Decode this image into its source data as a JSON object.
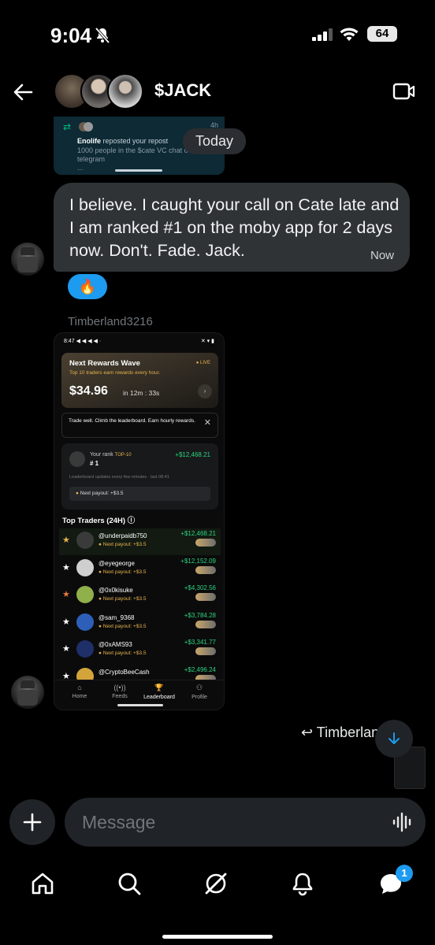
{
  "status_bar": {
    "time": "9:04",
    "battery": "64"
  },
  "header": {
    "title": "$JACK"
  },
  "repost_card": {
    "time": "4h",
    "user": "Enolife",
    "action": "reposted your repost",
    "text": "1000 people in the $cate VC chat o",
    "text2": "telegram",
    "more": "..."
  },
  "date_divider": "Today",
  "message": {
    "text": "I believe. I caught your call on Cate late and I am ranked #1 on the moby app for 2 days now. Don't. Fade. Jack.",
    "time": "Now",
    "reaction": "🔥"
  },
  "shared_by": "Timberland3216",
  "screenshot": {
    "status_time": "8:47",
    "rewards": {
      "title": "Next Rewards Wave",
      "live": "LIVE",
      "subtitle": "Top 10 traders earn rewards every hour.",
      "amount": "$34.96",
      "countdown": "in 12m : 33s"
    },
    "tip": "Trade well. Climb the leaderboard. Earn hourly rewards.",
    "rank": {
      "label": "Your rank",
      "tier": "TOP-10",
      "number": "# 1",
      "pnl": "+$12,468.21",
      "note": "Leaderboard updates every few minutes · last 08:41",
      "payout": "Next payout: +$3.5"
    },
    "top_title": "Top Traders (24H)",
    "traders": [
      {
        "name": "@underpaidb750",
        "payout": "Next payout: +$3.5",
        "pnl": "+$12,468.21",
        "star": "#e8b34c",
        "avatar": "#3a3a3a"
      },
      {
        "name": "@eyegeorge",
        "payout": "Next payout: +$3.5",
        "pnl": "+$12,152.09",
        "star": "#ffffff",
        "avatar": "#cfcfcf"
      },
      {
        "name": "@0x0kisuke",
        "payout": "Next payout: +$3.5",
        "pnl": "+$4,302.56",
        "star": "#e8783c",
        "avatar": "#8fb04a"
      },
      {
        "name": "@sam_9368",
        "payout": "Next payout: +$3.5",
        "pnl": "+$3,784.28",
        "star": "#ffffff",
        "avatar": "#2e5fb8"
      },
      {
        "name": "@0xAMS93",
        "payout": "Next payout: +$3.5",
        "pnl": "+$3,341.77",
        "star": "#ffffff",
        "avatar": "#1f2f6a"
      },
      {
        "name": "@CryptoBeeCash",
        "payout": "",
        "pnl": "+$2,496.24",
        "star": "#ffffff",
        "avatar": "#d3a43a"
      }
    ],
    "tabs": [
      "Home",
      "Feeds",
      "Leaderboard",
      "Profile"
    ]
  },
  "reply_preview": "Timberlanc",
  "composer": {
    "placeholder": "Message"
  },
  "nav_badge": "1",
  "colors": {
    "accent": "#1d9bf0",
    "bubble": "#2f3336",
    "gain": "#2bd47e",
    "gold": "#e8b34c"
  }
}
